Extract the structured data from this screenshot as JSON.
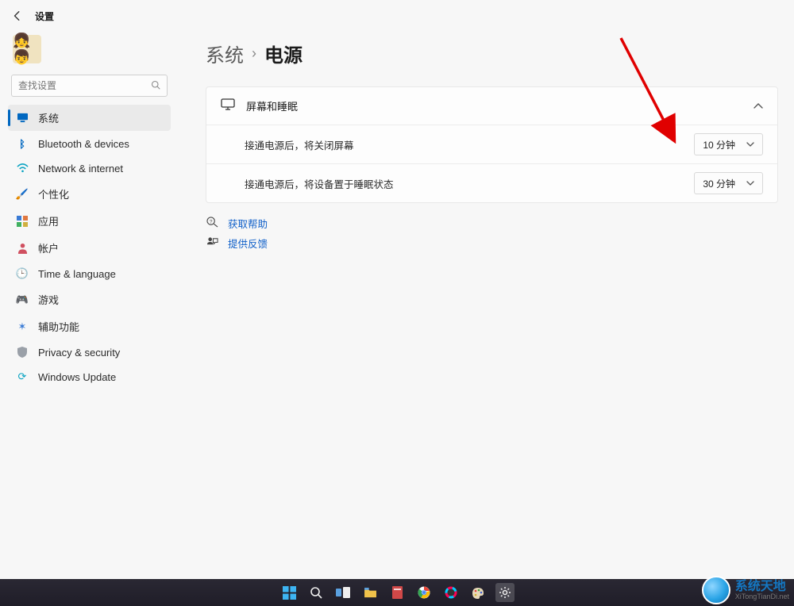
{
  "header": {
    "app_title": "设置"
  },
  "search": {
    "placeholder": "查找设置"
  },
  "nav": {
    "items": [
      {
        "label": "系统",
        "icon": "🖥️",
        "color": "#0067c0"
      },
      {
        "label": "Bluetooth & devices",
        "icon": "ᛒ",
        "color": "#0067c0"
      },
      {
        "label": "Network & internet",
        "icon": "📶",
        "color": "#0aa3c2"
      },
      {
        "label": "个性化",
        "icon": "🖌️",
        "color": "#d89a38"
      },
      {
        "label": "应用",
        "icon": "▦",
        "color": "#3a7bd5"
      },
      {
        "label": "帐户",
        "icon": "👤",
        "color": "#d05060"
      },
      {
        "label": "Time & language",
        "icon": "🕒",
        "color": "#3aa0d0"
      },
      {
        "label": "游戏",
        "icon": "🎮",
        "color": "#888"
      },
      {
        "label": "辅助功能",
        "icon": "✶",
        "color": "#3a7bd5"
      },
      {
        "label": "Privacy & security",
        "icon": "🛡️",
        "color": "#888"
      },
      {
        "label": "Windows Update",
        "icon": "⟳",
        "color": "#0aa3c2"
      }
    ]
  },
  "breadcrumb": {
    "parent": "系统",
    "separator": "›",
    "current": "电源"
  },
  "card": {
    "title": "屏幕和睡眠",
    "rows": [
      {
        "label": "接通电源后，将关闭屏幕",
        "value": "10 分钟"
      },
      {
        "label": "接通电源后，将设备置于睡眠状态",
        "value": "30 分钟"
      }
    ]
  },
  "help": {
    "get_help": "获取帮助",
    "feedback": "提供反馈"
  },
  "watermark": {
    "title": "系统天地",
    "sub": "XiTongTianDi.net"
  }
}
